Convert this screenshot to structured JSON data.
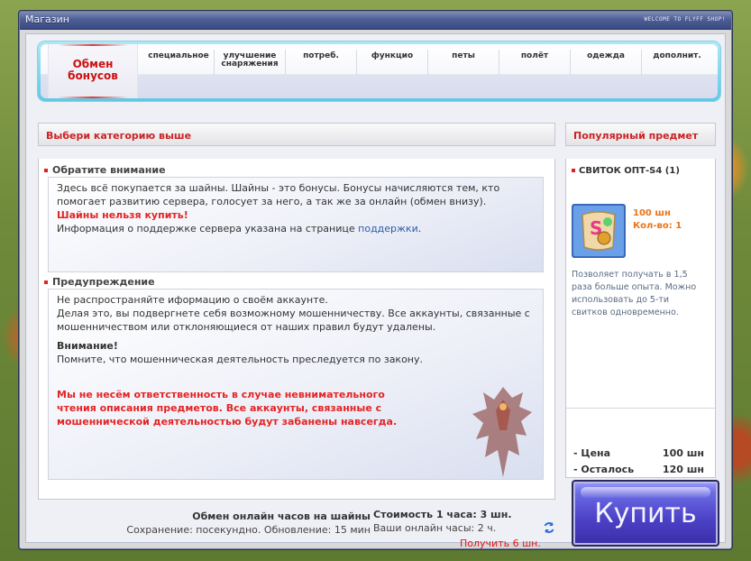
{
  "window": {
    "title": "Магазин",
    "title_right": "WELCOME TO FLYFF SHOP!"
  },
  "categories": {
    "active": "Обмен бонусов",
    "tabs": [
      {
        "label": "специальное"
      },
      {
        "label": "улучшение снаряжения"
      },
      {
        "label": "потреб."
      },
      {
        "label": "функцио"
      },
      {
        "label": "петы"
      },
      {
        "label": "полёт"
      },
      {
        "label": "одежда"
      },
      {
        "label": "дополнит."
      }
    ]
  },
  "main": {
    "header": "Выбери категорию выше",
    "notice": {
      "title": "Обратите внимание",
      "text1": "Здесь всё покупается за шайны. Шайны - это бонусы. Бонусы начисляются тем, кто помогает развитию сервера, голосует за него, а так же за онлайн (обмен внизу).",
      "warning": "Шайны нельзя купить!",
      "text2": "Информация о поддержке сервера указана на странице ",
      "link": "поддержки",
      "text2_end": "."
    },
    "caution": {
      "title": "Предупреждение",
      "text1": "Не распространяйте иформацию о своём аккаунте.",
      "text2": "Делая это, вы подвергнете себя возможному мошенничеству. Все аккаунты, связанные с мошенничеством или отклоняющиеся от наших правил будут удалены.",
      "attention_label": "Внимание!",
      "attention_text": "Помните, что мошенническая деятельность преследуется по закону.",
      "disclaimer": "Мы не несём ответственность в случае невнимательного чтения описания предметов. Все аккаунты, связанные с мошеннической деятельностью будут забанены навсегда."
    }
  },
  "exchange": {
    "title": "Обмен онлайн часов на шайны",
    "subtitle": "Сохранение: посекундно. Обновление: 15 мин",
    "cost": "Стоимость 1 часа: 3 шн.",
    "hours": "Ваши онлайн часы: 2 ч.",
    "receive": "Получить 6 шн."
  },
  "popular": {
    "header": "Популярный предмет",
    "item_name": "СВИТОК ОПТ-S4 (1)",
    "price": "100 шн",
    "qty": "Кол-во: 1",
    "description": "Позволяет получать в 1,5 раза больше опыта. Можно использовать до 5-ти свитков одновременно.",
    "price_label": "- Цена",
    "price_value": "100 шн",
    "remaining_label": "- Осталось",
    "remaining_value": "120 шн"
  },
  "buy_button": "Купить",
  "colors": {
    "accent_red": "#cc2222",
    "price_orange": "#e8741a",
    "button_purple": "#4c41c6",
    "titlebar": "#4e5f96"
  }
}
